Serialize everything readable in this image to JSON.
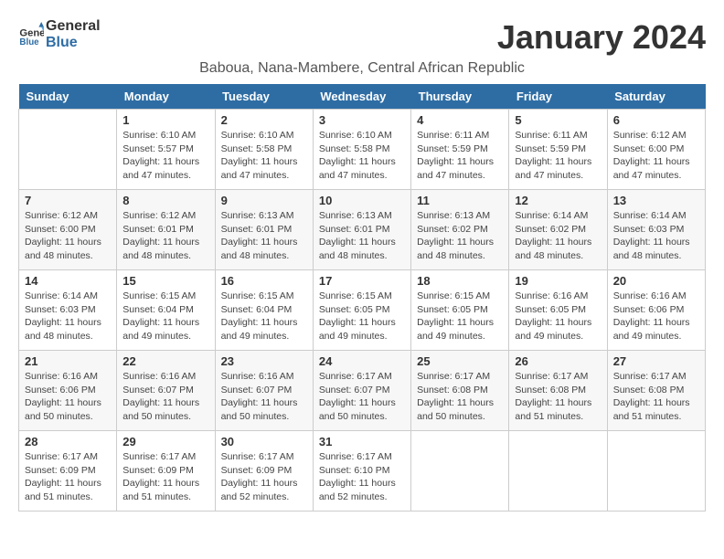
{
  "header": {
    "logo_line1": "General",
    "logo_line2": "Blue",
    "month": "January 2024",
    "location": "Baboua, Nana-Mambere, Central African Republic"
  },
  "weekdays": [
    "Sunday",
    "Monday",
    "Tuesday",
    "Wednesday",
    "Thursday",
    "Friday",
    "Saturday"
  ],
  "weeks": [
    [
      {
        "day": "",
        "info": ""
      },
      {
        "day": "1",
        "info": "Sunrise: 6:10 AM\nSunset: 5:57 PM\nDaylight: 11 hours\nand 47 minutes."
      },
      {
        "day": "2",
        "info": "Sunrise: 6:10 AM\nSunset: 5:58 PM\nDaylight: 11 hours\nand 47 minutes."
      },
      {
        "day": "3",
        "info": "Sunrise: 6:10 AM\nSunset: 5:58 PM\nDaylight: 11 hours\nand 47 minutes."
      },
      {
        "day": "4",
        "info": "Sunrise: 6:11 AM\nSunset: 5:59 PM\nDaylight: 11 hours\nand 47 minutes."
      },
      {
        "day": "5",
        "info": "Sunrise: 6:11 AM\nSunset: 5:59 PM\nDaylight: 11 hours\nand 47 minutes."
      },
      {
        "day": "6",
        "info": "Sunrise: 6:12 AM\nSunset: 6:00 PM\nDaylight: 11 hours\nand 47 minutes."
      }
    ],
    [
      {
        "day": "7",
        "info": "Sunrise: 6:12 AM\nSunset: 6:00 PM\nDaylight: 11 hours\nand 48 minutes."
      },
      {
        "day": "8",
        "info": "Sunrise: 6:12 AM\nSunset: 6:01 PM\nDaylight: 11 hours\nand 48 minutes."
      },
      {
        "day": "9",
        "info": "Sunrise: 6:13 AM\nSunset: 6:01 PM\nDaylight: 11 hours\nand 48 minutes."
      },
      {
        "day": "10",
        "info": "Sunrise: 6:13 AM\nSunset: 6:01 PM\nDaylight: 11 hours\nand 48 minutes."
      },
      {
        "day": "11",
        "info": "Sunrise: 6:13 AM\nSunset: 6:02 PM\nDaylight: 11 hours\nand 48 minutes."
      },
      {
        "day": "12",
        "info": "Sunrise: 6:14 AM\nSunset: 6:02 PM\nDaylight: 11 hours\nand 48 minutes."
      },
      {
        "day": "13",
        "info": "Sunrise: 6:14 AM\nSunset: 6:03 PM\nDaylight: 11 hours\nand 48 minutes."
      }
    ],
    [
      {
        "day": "14",
        "info": "Sunrise: 6:14 AM\nSunset: 6:03 PM\nDaylight: 11 hours\nand 48 minutes."
      },
      {
        "day": "15",
        "info": "Sunrise: 6:15 AM\nSunset: 6:04 PM\nDaylight: 11 hours\nand 49 minutes."
      },
      {
        "day": "16",
        "info": "Sunrise: 6:15 AM\nSunset: 6:04 PM\nDaylight: 11 hours\nand 49 minutes."
      },
      {
        "day": "17",
        "info": "Sunrise: 6:15 AM\nSunset: 6:05 PM\nDaylight: 11 hours\nand 49 minutes."
      },
      {
        "day": "18",
        "info": "Sunrise: 6:15 AM\nSunset: 6:05 PM\nDaylight: 11 hours\nand 49 minutes."
      },
      {
        "day": "19",
        "info": "Sunrise: 6:16 AM\nSunset: 6:05 PM\nDaylight: 11 hours\nand 49 minutes."
      },
      {
        "day": "20",
        "info": "Sunrise: 6:16 AM\nSunset: 6:06 PM\nDaylight: 11 hours\nand 49 minutes."
      }
    ],
    [
      {
        "day": "21",
        "info": "Sunrise: 6:16 AM\nSunset: 6:06 PM\nDaylight: 11 hours\nand 50 minutes."
      },
      {
        "day": "22",
        "info": "Sunrise: 6:16 AM\nSunset: 6:07 PM\nDaylight: 11 hours\nand 50 minutes."
      },
      {
        "day": "23",
        "info": "Sunrise: 6:16 AM\nSunset: 6:07 PM\nDaylight: 11 hours\nand 50 minutes."
      },
      {
        "day": "24",
        "info": "Sunrise: 6:17 AM\nSunset: 6:07 PM\nDaylight: 11 hours\nand 50 minutes."
      },
      {
        "day": "25",
        "info": "Sunrise: 6:17 AM\nSunset: 6:08 PM\nDaylight: 11 hours\nand 50 minutes."
      },
      {
        "day": "26",
        "info": "Sunrise: 6:17 AM\nSunset: 6:08 PM\nDaylight: 11 hours\nand 51 minutes."
      },
      {
        "day": "27",
        "info": "Sunrise: 6:17 AM\nSunset: 6:08 PM\nDaylight: 11 hours\nand 51 minutes."
      }
    ],
    [
      {
        "day": "28",
        "info": "Sunrise: 6:17 AM\nSunset: 6:09 PM\nDaylight: 11 hours\nand 51 minutes."
      },
      {
        "day": "29",
        "info": "Sunrise: 6:17 AM\nSunset: 6:09 PM\nDaylight: 11 hours\nand 51 minutes."
      },
      {
        "day": "30",
        "info": "Sunrise: 6:17 AM\nSunset: 6:09 PM\nDaylight: 11 hours\nand 52 minutes."
      },
      {
        "day": "31",
        "info": "Sunrise: 6:17 AM\nSunset: 6:10 PM\nDaylight: 11 hours\nand 52 minutes."
      },
      {
        "day": "",
        "info": ""
      },
      {
        "day": "",
        "info": ""
      },
      {
        "day": "",
        "info": ""
      }
    ]
  ]
}
